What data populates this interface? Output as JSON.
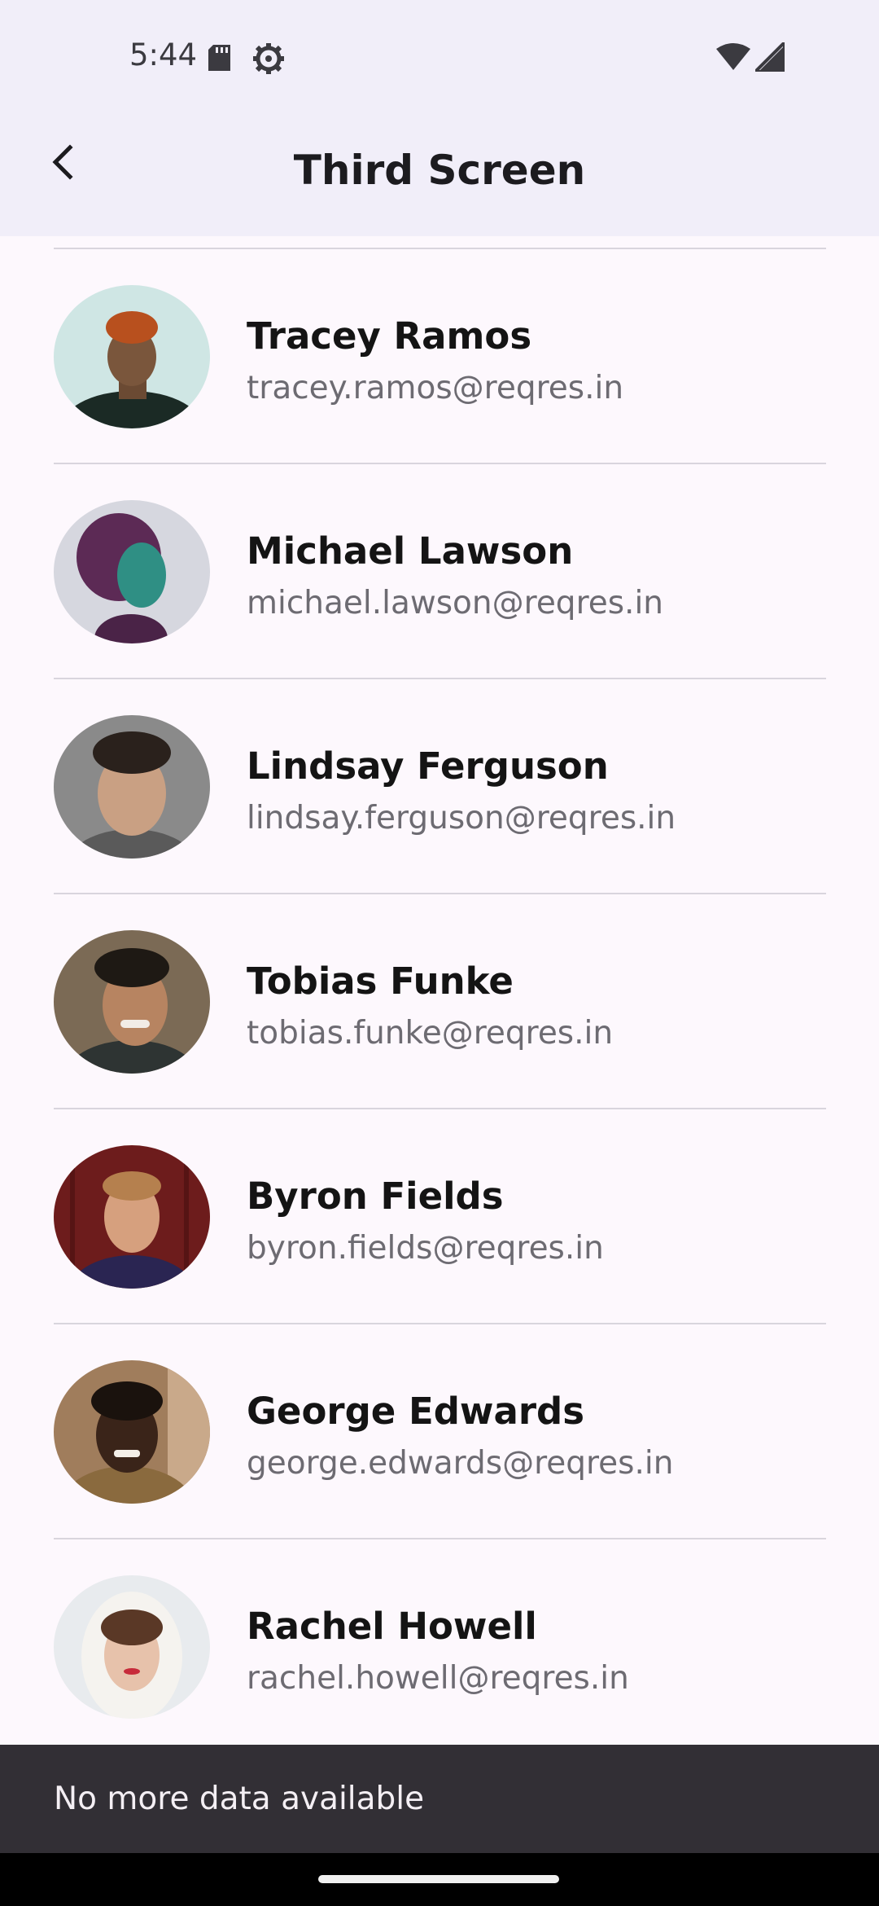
{
  "status_bar": {
    "time": "5:44"
  },
  "app_bar": {
    "title": "Third Screen",
    "back_icon": "chevron-left-icon"
  },
  "users": [
    {
      "name": "Tracey Ramos",
      "email": "tracey.ramos@reqres.in"
    },
    {
      "name": "Michael Lawson",
      "email": "michael.lawson@reqres.in"
    },
    {
      "name": "Lindsay Ferguson",
      "email": "lindsay.ferguson@reqres.in"
    },
    {
      "name": "Tobias Funke",
      "email": "tobias.funke@reqres.in"
    },
    {
      "name": "Byron Fields",
      "email": "byron.fields@reqres.in"
    },
    {
      "name": "George Edwards",
      "email": "george.edwards@reqres.in"
    },
    {
      "name": "Rachel Howell",
      "email": "rachel.howell@reqres.in"
    }
  ],
  "snackbar": {
    "message": "No more data available"
  },
  "colors": {
    "app_bar_background": "#f1eef9",
    "page_background": "#fdf8fd",
    "snackbar_background": "#322f35",
    "email_text": "#6d6b72"
  }
}
